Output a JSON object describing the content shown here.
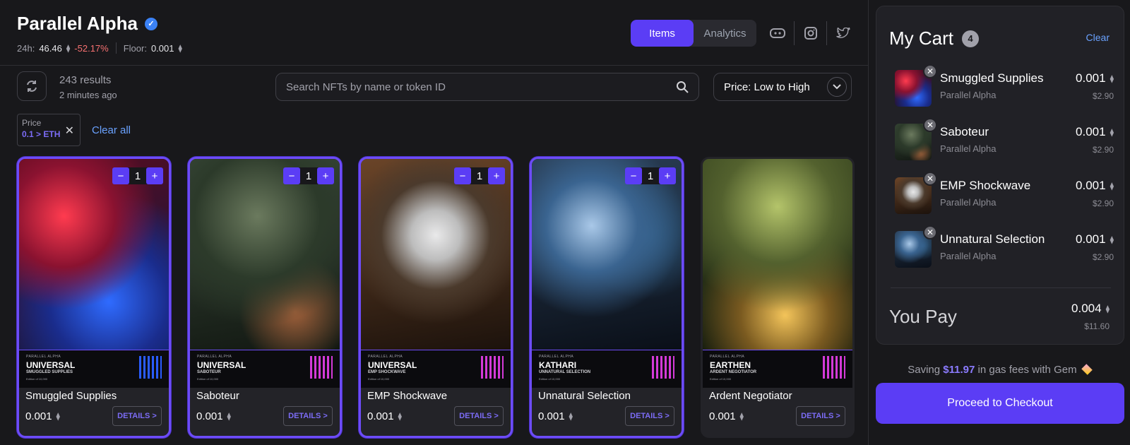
{
  "header": {
    "title": "Parallel Alpha",
    "stats": {
      "label_24h": "24h:",
      "volume": "46.46",
      "change": "-52.17%",
      "label_floor": "Floor:",
      "floor": "0.001"
    },
    "tabs": [
      {
        "label": "Items",
        "active": true
      },
      {
        "label": "Analytics",
        "active": false
      }
    ],
    "socials": [
      "discord-icon",
      "instagram-icon",
      "twitter-icon"
    ]
  },
  "toolbar": {
    "results": "243 results",
    "updated": "2 minutes ago",
    "search_placeholder": "Search NFTs by name or token ID",
    "sort_label": "Price: Low to High"
  },
  "filters": {
    "chip_key": "Price",
    "chip_value": "0.1 > ETH",
    "clear_all": "Clear all"
  },
  "items": [
    {
      "name": "Smuggled Supplies",
      "price": "0.001",
      "qty": "1",
      "selected": true,
      "details": "DETAILS >",
      "set": "PARALLEL ALPHA",
      "faction": "UNIVERSAL",
      "card_sub": "SMUGGLED SUPPLIES",
      "edition": "Edition of 10,000"
    },
    {
      "name": "Saboteur",
      "price": "0.001",
      "qty": "1",
      "selected": true,
      "details": "DETAILS >",
      "set": "PARALLEL ALPHA",
      "faction": "UNIVERSAL",
      "card_sub": "SABOTEUR",
      "edition": "Edition of 10,000"
    },
    {
      "name": "EMP Shockwave",
      "price": "0.001",
      "qty": "1",
      "selected": true,
      "details": "DETAILS >",
      "set": "PARALLEL ALPHA",
      "faction": "UNIVERSAL",
      "card_sub": "EMP SHOCKWAVE",
      "edition": "Edition of 10,000"
    },
    {
      "name": "Unnatural Selection",
      "price": "0.001",
      "qty": "1",
      "selected": true,
      "details": "DETAILS >",
      "set": "PARALLEL ALPHA",
      "faction": "KATHARI",
      "card_sub": "UNNATURAL SELECTION",
      "edition": "Edition of 10,000"
    },
    {
      "name": "Ardent Negotiator",
      "price": "0.001",
      "qty": "",
      "selected": false,
      "details": "DETAILS >",
      "set": "PARALLEL ALPHA",
      "faction": "EARTHEN",
      "card_sub": "ARDENT NEGOTIATOR",
      "edition": "Edition of 10,000"
    }
  ],
  "cart": {
    "title": "My Cart",
    "count": "4",
    "clear": "Clear",
    "items": [
      {
        "name": "Smuggled Supplies",
        "collection": "Parallel Alpha",
        "price": "0.001",
        "usd": "$2.90"
      },
      {
        "name": "Saboteur",
        "collection": "Parallel Alpha",
        "price": "0.001",
        "usd": "$2.90"
      },
      {
        "name": "EMP Shockwave",
        "collection": "Parallel Alpha",
        "price": "0.001",
        "usd": "$2.90"
      },
      {
        "name": "Unnatural Selection",
        "collection": "Parallel Alpha",
        "price": "0.001",
        "usd": "$2.90"
      }
    ],
    "you_pay_label": "You Pay",
    "total": "0.004",
    "total_usd": "$11.60",
    "saving_prefix": "Saving",
    "saving_amount": "$11.97",
    "saving_suffix": "in gas fees with Gem",
    "checkout": "Proceed to Checkout"
  },
  "colors": {
    "accent": "#5b3df5",
    "link": "#6aa2ff",
    "negative": "#f87171",
    "background": "#18181b"
  }
}
